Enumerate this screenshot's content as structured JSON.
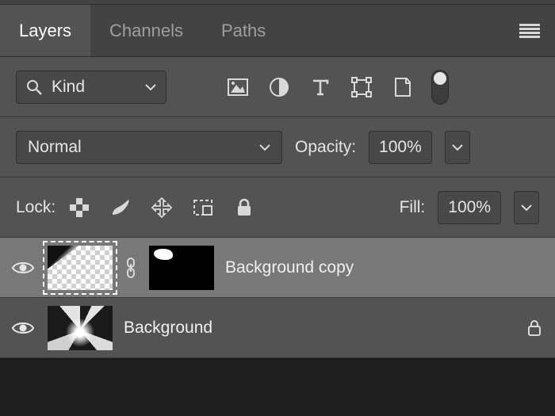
{
  "tabs": {
    "layers": "Layers",
    "channels": "Channels",
    "paths": "Paths"
  },
  "filter": {
    "kind_label": "Kind"
  },
  "blend": {
    "mode": "Normal",
    "opacity_label": "Opacity:",
    "opacity_value": "100%"
  },
  "lock": {
    "label": "Lock:",
    "fill_label": "Fill:",
    "fill_value": "100%"
  },
  "layers": [
    {
      "name": "Background copy"
    },
    {
      "name": "Background"
    }
  ],
  "icons": {
    "menu": "panel-menu",
    "search": "search",
    "image": "image-filter",
    "adjust": "adjustment-filter",
    "type": "type-filter",
    "shape": "shape-filter",
    "smart": "smartobject-filter",
    "transparency": "lock-transparency",
    "brush": "lock-brush",
    "move": "lock-move",
    "artboard": "lock-artboard",
    "lockall": "lock-all"
  }
}
